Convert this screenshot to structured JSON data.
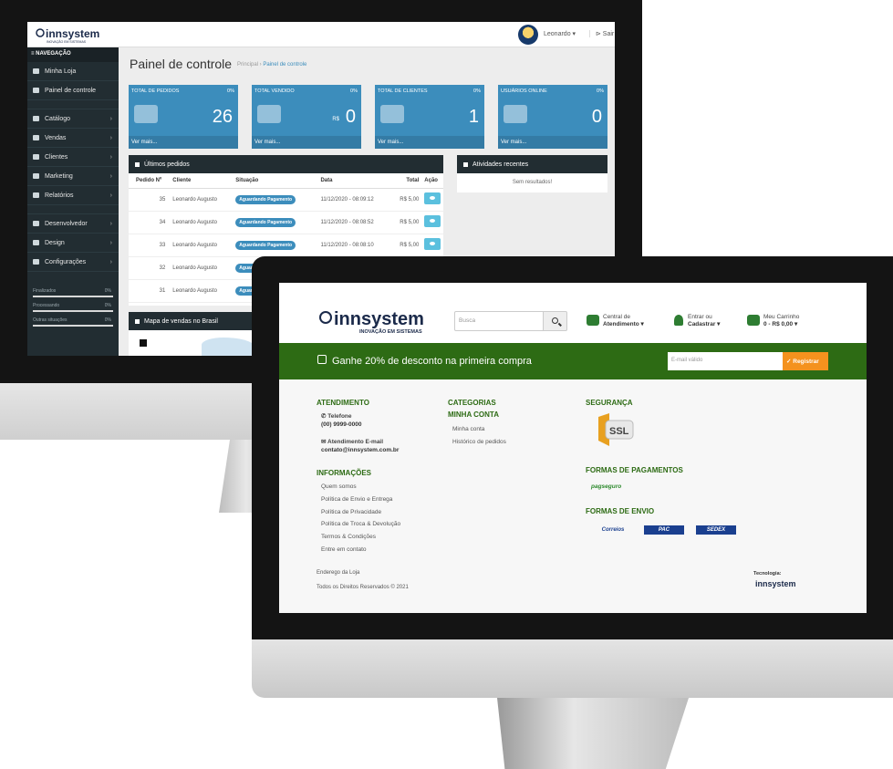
{
  "admin": {
    "brand": "innsystem",
    "brand_tagline": "INOVAÇÃO EM SISTEMAS",
    "user": "Leonardo ▾",
    "logout": "⊳ Sair",
    "nav_header": "≡ NAVEGAÇÃO",
    "sidebar_items": [
      {
        "label": "Minha Loja",
        "icon": "desktop-icon",
        "chevron": false
      },
      {
        "label": "Painel de controle",
        "icon": "home-icon",
        "chevron": false
      },
      {
        "label": "Catálogo",
        "icon": "tag-icon",
        "chevron": true
      },
      {
        "label": "Vendas",
        "icon": "cart-icon",
        "chevron": true
      },
      {
        "label": "Clientes",
        "icon": "user-icon",
        "chevron": true
      },
      {
        "label": "Marketing",
        "icon": "share-icon",
        "chevron": true
      },
      {
        "label": "Relatórios",
        "icon": "bar-chart-icon",
        "chevron": true
      },
      {
        "label": "Desenvolvedor",
        "icon": "code-icon",
        "chevron": true
      },
      {
        "label": "Design",
        "icon": "monitor-icon",
        "chevron": true
      },
      {
        "label": "Configurações",
        "icon": "gear-icon",
        "chevron": true
      }
    ],
    "sidebar_stats": [
      {
        "label": "Finalizados",
        "value": "0%"
      },
      {
        "label": "Processando",
        "value": "0%"
      },
      {
        "label": "Outras situações",
        "value": "0%"
      }
    ],
    "page_title": "Painel de controle",
    "breadcrumb": {
      "home": "Principal",
      "sep": " › ",
      "current": "Painel de controle"
    },
    "kpis": [
      {
        "label": "TOTAL DE PEDIDOS",
        "pct": "0%",
        "value": "26",
        "currency": "",
        "more": "Ver mais...",
        "icon": "cart-icon"
      },
      {
        "label": "TOTAL VENDIDO",
        "pct": "0%",
        "value": "0",
        "currency": "R$",
        "more": "Ver mais...",
        "icon": "credit-card-icon"
      },
      {
        "label": "TOTAL DE CLIENTES",
        "pct": "0%",
        "value": "1",
        "currency": "",
        "more": "Ver mais...",
        "icon": "user-icon"
      },
      {
        "label": "USUÁRIOS ONLINE",
        "pct": "0%",
        "value": "0",
        "currency": "",
        "more": "Ver mais...",
        "icon": "users-icon"
      }
    ],
    "orders_title": "Últimos pedidos",
    "orders_columns": [
      "Pedido Nº",
      "Cliente",
      "Situação",
      "Data",
      "Total",
      "Ação"
    ],
    "orders": [
      {
        "id": "35",
        "client": "Leonardo Augusto",
        "status": "Aguardando Pagamento",
        "date": "11/12/2020 - 08:09:12",
        "total": "R$ 5,00"
      },
      {
        "id": "34",
        "client": "Leonardo Augusto",
        "status": "Aguardando Pagamento",
        "date": "11/12/2020 - 08:08:52",
        "total": "R$ 5,00"
      },
      {
        "id": "33",
        "client": "Leonardo Augusto",
        "status": "Aguardando Pagamento",
        "date": "11/12/2020 - 08:08:10",
        "total": "R$ 5,00"
      },
      {
        "id": "32",
        "client": "Leonardo Augusto",
        "status": "Aguard",
        "date": "",
        "total": ""
      },
      {
        "id": "31",
        "client": "Leonardo Augusto",
        "status": "Aguard",
        "date": "",
        "total": ""
      }
    ],
    "recent_title": "Atividades recentes",
    "recent_empty": "Sem resultados!",
    "map_title": "Mapa de vendas no Brasil"
  },
  "store": {
    "brand": "innsystem",
    "brand_tagline": "INOVAÇÃO EM SISTEMAS",
    "search_placeholder": "Busca",
    "support": {
      "line1": "Central de",
      "line2": "Atendimento ▾"
    },
    "account": {
      "line1": "Entrar ou",
      "line2": "Cadastrar ▾"
    },
    "cart": {
      "line1": "Meu Carrinho",
      "line2": "0 - R$ 0,00 ▾"
    },
    "promo_text": "Ganhe 20% de desconto na primeira compra",
    "newsletter_placeholder": "E-mail válido",
    "newsletter_button": "✓ Registrar",
    "footer": {
      "atendimento_title": "ATENDIMENTO",
      "phone_label": "✆ Telefone",
      "phone": "(00) 9999-0000",
      "email_label": "✉ Atendimento E-mail",
      "email": "contato@innsystem.com.br",
      "info_title": "INFORMAÇÕES",
      "info_links": [
        "Quem somos",
        "Política de Envio e Entrega",
        "Política de Privacidade",
        "Política de Troca & Devolução",
        "Termos & Condições",
        "Entre em contato"
      ],
      "categorias_title": "CATEGORIAS",
      "conta_title": "MINHA CONTA",
      "conta_links": [
        "Minha conta",
        "Histórico de pedidos"
      ],
      "seguranca_title": "SEGURANÇA",
      "ssl_text": "SSL",
      "pagamentos_title": "FORMAS DE PAGAMENTOS",
      "pagseguro": "pagseguro",
      "envio_title": "FORMAS DE ENVIO",
      "shipping": [
        "Correios",
        "PAC",
        "SEDEX"
      ],
      "address": "Enderego da Loja",
      "rights": "Todos os Direitos Reservados © 2021",
      "tech_label": "Tecnologia:",
      "tech_brand": "innsystem"
    }
  },
  "colors": {
    "admin_blue": "#3c8dbc",
    "sidebar": "#222d32",
    "store_green": "#2d6b14",
    "accent_orange": "#f4921e"
  }
}
